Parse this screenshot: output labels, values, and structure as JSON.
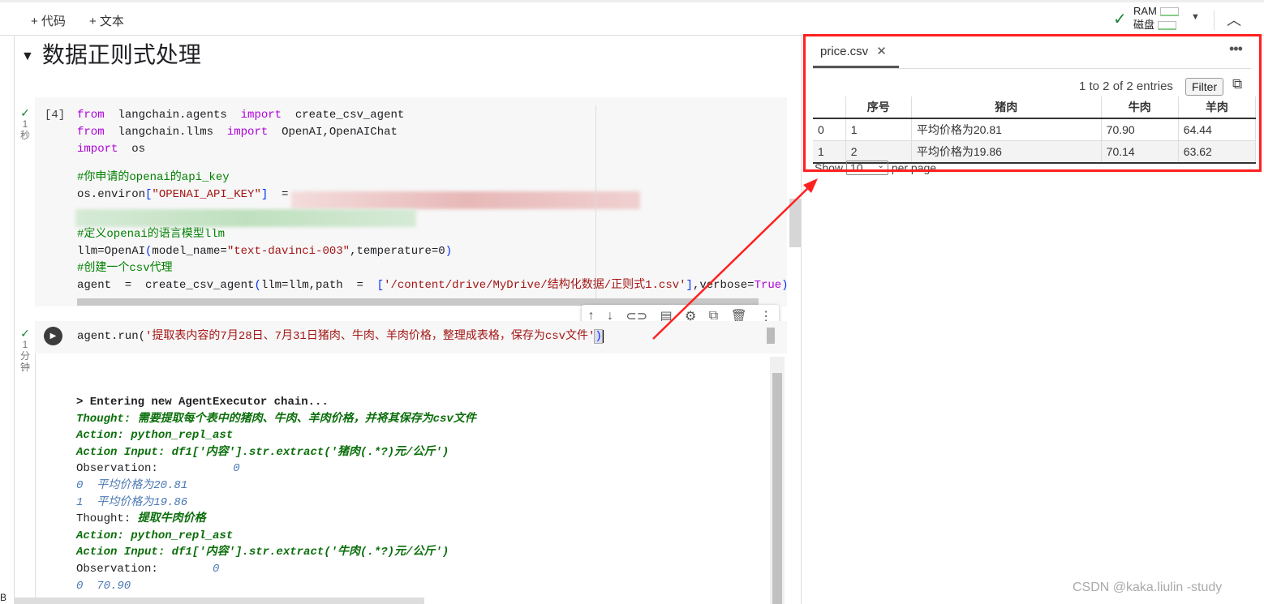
{
  "toolbar": {
    "add_code": "+ 代码",
    "add_text": "+ 文本",
    "ram_label": "RAM",
    "disk_label": "磁盘"
  },
  "section": {
    "title": "数据正则式处理"
  },
  "cell1": {
    "exec_count": "[4]",
    "status_time": [
      "1",
      "秒"
    ],
    "lines": [
      [
        [
          "kw",
          "from"
        ],
        [
          "",
          "  langchain.agents  "
        ],
        [
          "kw",
          "import"
        ],
        [
          "",
          "  create_csv_agent"
        ]
      ],
      [
        [
          "kw",
          "from"
        ],
        [
          "",
          "  langchain.llms  "
        ],
        [
          "kw",
          "import"
        ],
        [
          "",
          "  OpenAI,OpenAIChat"
        ]
      ],
      [
        [
          "kw",
          "import"
        ],
        [
          "",
          "  os"
        ]
      ],
      [],
      [
        [
          "cm",
          "#你申请的openai的api_key"
        ]
      ],
      [
        [
          "",
          "os.environ"
        ],
        [
          "br",
          "["
        ],
        [
          "str",
          "\"OPENAI_API_KEY\""
        ],
        [
          "br",
          "]"
        ],
        [
          "",
          "  = "
        ]
      ],
      [],
      [],
      [
        [
          "cm",
          "#定义openai的语言模型llm"
        ]
      ],
      [
        [
          "",
          "llm=OpenAI"
        ],
        [
          "br",
          "("
        ],
        [
          "",
          "model_name="
        ],
        [
          "str",
          "\"text-davinci-003\""
        ],
        [
          "",
          ",temperature=0"
        ],
        [
          "br",
          ")"
        ]
      ],
      [
        [
          "cm",
          "#创建一个csv代理"
        ]
      ],
      [
        [
          "",
          "agent  =  create_csv_agent"
        ],
        [
          "br",
          "("
        ],
        [
          "",
          "llm=llm,path  =  "
        ],
        [
          "br",
          "["
        ],
        [
          "str",
          "'/content/drive/MyDrive/结构化数据/正则式1.csv'"
        ],
        [
          "br",
          "]"
        ],
        [
          "",
          ",verbose="
        ],
        [
          "kw",
          "True"
        ],
        [
          "br",
          ")"
        ]
      ]
    ]
  },
  "cell2": {
    "status_time": [
      "1",
      "分",
      "钟"
    ],
    "code_prefix": "agent.run(",
    "code_string": "'提取表内容的7月28日、7月31日猪肉、牛肉、羊肉价格，整理成表格，保存为csv文件'",
    "code_suffix": ")",
    "output": [
      [
        [
          "bold",
          "> Entering new AgentExecutor chain..."
        ]
      ],
      [
        [
          "g",
          "Thought: 需要提取每个表中的猪肉、牛肉、羊肉价格，并将其保存为csv文件"
        ]
      ],
      [
        [
          "g",
          "Action: python_repl_ast"
        ]
      ],
      [
        [
          "g",
          "Action Input: df1['内容'].str.extract('猪肉(.*?)元/公斤')"
        ]
      ],
      [
        [
          "",
          "Observation:           "
        ],
        [
          "b",
          "0"
        ]
      ],
      [
        [
          "b",
          "0  平均价格为20.81"
        ]
      ],
      [
        [
          "b",
          "1  平均价格为19.86"
        ]
      ],
      [
        [
          "",
          "Thought: "
        ],
        [
          "g",
          "提取牛肉价格"
        ]
      ],
      [
        [
          "g",
          "Action: python_repl_ast"
        ]
      ],
      [
        [
          "g",
          "Action Input: df1['内容'].str.extract('牛肉(.*?)元/公斤')"
        ]
      ],
      [
        [
          "",
          "Observation:        "
        ],
        [
          "b",
          "0"
        ]
      ],
      [
        [
          "b",
          "0  70.90"
        ]
      ]
    ]
  },
  "panel": {
    "tab_label": "price.csv",
    "entries_text": "1 to 2 of 2 entries",
    "filter_label": "Filter",
    "show_label": "Show",
    "per_page_value": "10",
    "per_page_label": "per page",
    "columns": [
      "",
      "序号",
      "猪肉",
      "牛肉",
      "羊肉"
    ],
    "rows": [
      [
        "0",
        "1",
        "平均价格为20.81",
        "70.90",
        "64.44"
      ],
      [
        "1",
        "2",
        "平均价格为19.86",
        "70.14",
        "63.62"
      ]
    ]
  },
  "watermark": "CSDN @kaka.liulin -study",
  "colors": {
    "highlight_box": "#ff2020",
    "arrow": "#ff2020",
    "check": "#188038"
  }
}
